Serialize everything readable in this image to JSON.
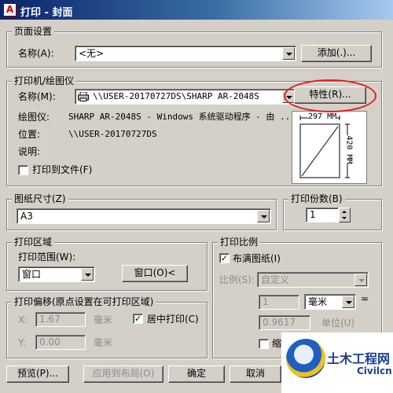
{
  "window": {
    "title": "打印 - 封面",
    "icon": "autocad-icon"
  },
  "page_setup": {
    "group_title": "页面设置",
    "name_label": "名称(A):",
    "name_value": "<无>",
    "add_button": "添加(.)..."
  },
  "printer": {
    "group_title": "打印机/绘图仪",
    "name_label": "名称(M):",
    "name_value": "\\\\USER-20170727DS\\SHARP AR-2048S",
    "properties_button": "特性(R)...",
    "plotter_label": "绘图仪:",
    "plotter_value": "SHARP AR-2048S - Windows 系统驱动程序 - 由 ...",
    "location_label": "位置:",
    "location_value": "\\\\USER-20170727DS",
    "description_label": "说明:",
    "print_to_file_label": "打印到文件(F)",
    "print_to_file_checked": false,
    "preview_width": "297 MM",
    "preview_height": "420 MM"
  },
  "paper_size": {
    "group_title": "图纸尺寸(Z)",
    "value": "A3"
  },
  "copies": {
    "group_title": "打印份数(B)",
    "value": "1"
  },
  "plot_area": {
    "group_title": "打印区域",
    "range_label": "打印范围(W):",
    "range_value": "窗口",
    "window_button": "窗口(O)<"
  },
  "plot_offset": {
    "group_title": "打印偏移(原点设置在可打印区域)",
    "x_label": "X:",
    "x_value": "1.67",
    "x_unit": "毫米",
    "y_label": "Y:",
    "y_value": "0.00",
    "y_unit": "毫米",
    "center_label": "居中打印(C)",
    "center_checked": true
  },
  "plot_scale": {
    "group_title": "打印比例",
    "fit_label": "布满图纸(I)",
    "fit_checked": true,
    "scale_label": "比例(S):",
    "scale_value": "自定义",
    "value1": "1",
    "unit_value": "毫米",
    "equals": "=",
    "value2": "0.9617",
    "unit_label": "单位(U)",
    "lineweight_partial": "缩"
  },
  "buttons": {
    "preview": "预览(P)...",
    "apply_layout": "应用到布局(O)",
    "ok": "确定",
    "cancel": "取消"
  },
  "watermark": {
    "text": "土木工程网",
    "sub": "Civilcn"
  },
  "colors": {
    "annotation_circle": "#e02020",
    "title_bar": "#0a246a"
  }
}
